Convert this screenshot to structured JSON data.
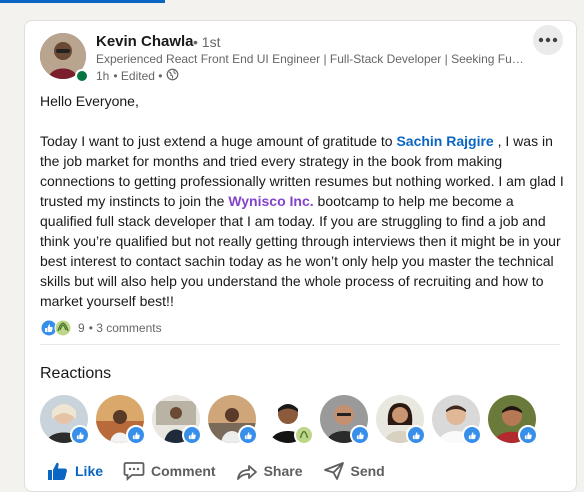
{
  "post": {
    "author": {
      "name": "Kevin Chawla",
      "degree": "• 1st",
      "headline": "Experienced React Front End UI Engineer | Full-Stack Developer | Seeking Full-Time Opportunities",
      "time": "1h",
      "edited": "• Edited •"
    },
    "greeting": "Hello Everyone,",
    "body_parts": {
      "part1": "Today I want to just extend a huge amount of gratitude to ",
      "mention": "Sachin Rajgire",
      "part2": " , I was in the job market for months and tried every strategy in the book from making connections to getting professionally written resumes but nothing worked. I am glad I trusted my instincts to join the ",
      "company": "Wynisco Inc.",
      "part3": " bootcamp to help me become a qualified full stack developer that I am today. If you are struggling to find a job and think you’re qualified but not really getting through interviews then it might be in your best interest to contact sachin today as he won’t only help you master the technical skills but will also help you understand the whole process of recruiting and how to market yourself best!!"
    },
    "social": {
      "reaction_count": "9",
      "comments": "• 3 comments"
    }
  },
  "reactions_section": {
    "title": "Reactions",
    "reactors": [
      {
        "badge": "like"
      },
      {
        "badge": "like"
      },
      {
        "badge": "like"
      },
      {
        "badge": "like"
      },
      {
        "badge": "support"
      },
      {
        "badge": "like"
      },
      {
        "badge": "like"
      },
      {
        "badge": "like"
      },
      {
        "badge": "like"
      }
    ]
  },
  "actions": {
    "like": "Like",
    "comment": "Comment",
    "share": "Share",
    "send": "Send"
  },
  "colors": {
    "link_blue": "#0a66c2",
    "company_purple": "#8344cc",
    "presence_green": "#057642",
    "muted_text": "#666666"
  },
  "icons": [
    "more-options-icon",
    "globe-icon",
    "like-reaction-icon",
    "support-reaction-icon",
    "thumbs-up-icon",
    "comment-icon",
    "share-icon",
    "send-icon"
  ]
}
